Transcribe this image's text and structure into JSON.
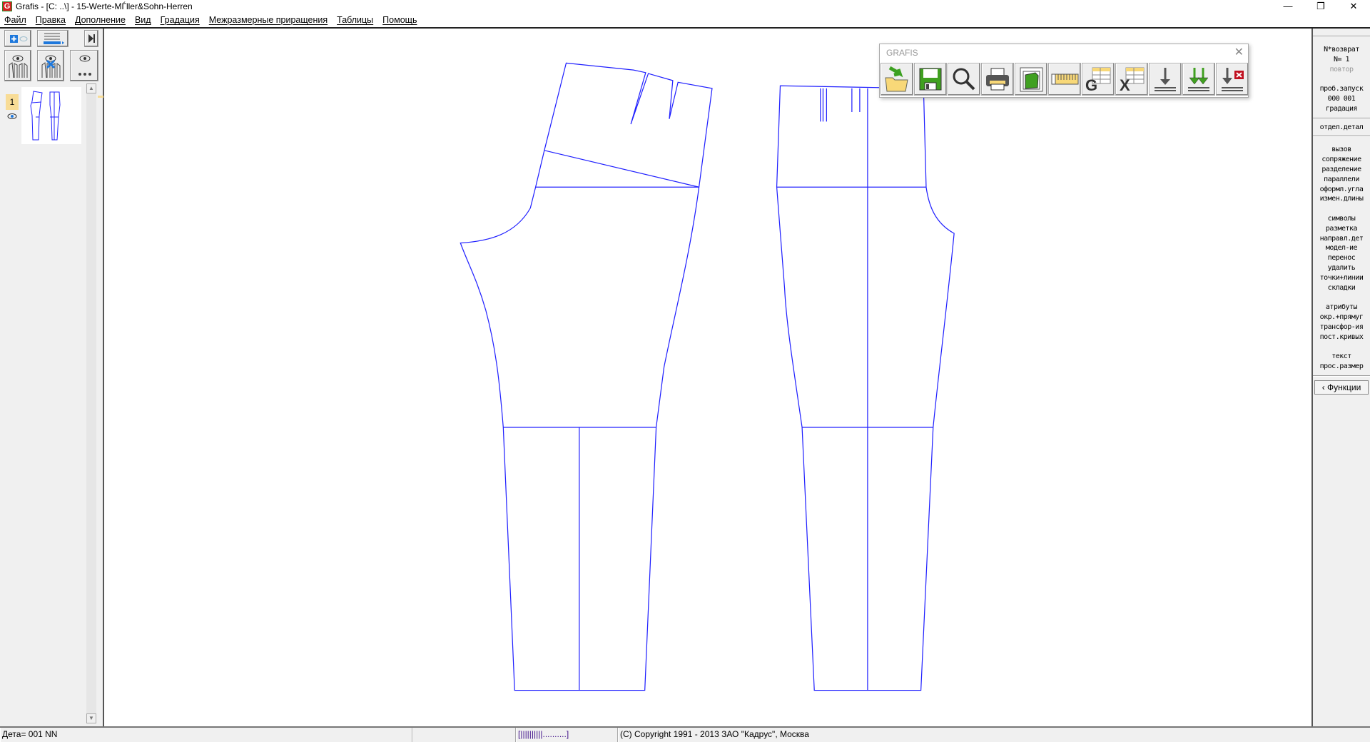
{
  "window": {
    "title": "Grafis - [C: ..\\] - 15-Werte-MЃller&Sohn-Herren",
    "icon_letter": "G",
    "minimize": "—",
    "restore": "❐",
    "close": "✕"
  },
  "menu": [
    "Файл",
    "Правка",
    "Дополнение",
    "Вид",
    "Градация",
    "Межразмерные приращения",
    "Таблицы",
    "Помощь"
  ],
  "layers": {
    "number": "1"
  },
  "toolwindow": {
    "title": "GRAFIS",
    "tools": [
      "open-file",
      "save",
      "zoom",
      "print",
      "piece-view",
      "measure",
      "grafis-table",
      "excel-table",
      "import",
      "import-all",
      "import-cancel"
    ]
  },
  "right_panel": {
    "groups": [
      {
        "items": [
          {
            "t": "N*возврат"
          },
          {
            "t": "N=  1"
          },
          {
            "t": "повтор",
            "gray": true
          }
        ]
      },
      {
        "items": [
          {
            "t": "проб.запуск"
          },
          {
            "t": "000 001"
          },
          {
            "t": "градация"
          }
        ]
      },
      {
        "items": [
          {
            "t": "отдел.детал"
          }
        ]
      },
      {
        "items": [
          {
            "t": "вызов"
          },
          {
            "t": "сопряжение"
          },
          {
            "t": "разделение"
          },
          {
            "t": "параллели"
          },
          {
            "t": "оформл.угла"
          },
          {
            "t": "измен.длины"
          },
          {
            "t": ""
          },
          {
            "t": "символы"
          },
          {
            "t": "разметка"
          },
          {
            "t": "направл.дет"
          },
          {
            "t": "модел-ие"
          },
          {
            "t": "перенос"
          },
          {
            "t": "удалить"
          },
          {
            "t": "точки+линии"
          },
          {
            "t": "складки"
          },
          {
            "t": ""
          },
          {
            "t": "атрибуты"
          },
          {
            "t": "окр.+прямуг"
          },
          {
            "t": "трансфор-ия"
          },
          {
            "t": "пост.кривых"
          },
          {
            "t": ""
          },
          {
            "t": "текст"
          },
          {
            "t": "прос.размер"
          }
        ]
      }
    ],
    "functions_button": "‹ Функции"
  },
  "status": {
    "detail": "Дета= 001  NN",
    "empty": "",
    "progress": "[||||||||||..........]",
    "copyright": "(C) Copyright 1991 - 2013 ЗАО \"Кадрус\", Москва"
  },
  "colors": {
    "pattern": "#2020ff",
    "accent": "#f8dc96"
  }
}
